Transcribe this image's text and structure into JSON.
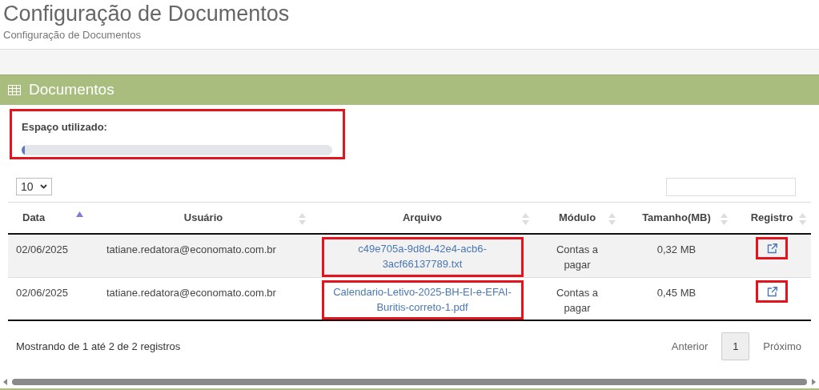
{
  "page": {
    "title": "Configuração de Documentos",
    "subtitle": "Configuração de Documentos"
  },
  "panel": {
    "title": "Documentos"
  },
  "space_usage": {
    "label": "Espaço utilizado:",
    "level": 0.01,
    "highlighted": true
  },
  "page_length": {
    "value": "10"
  },
  "table": {
    "columns": [
      {
        "label": "Data",
        "sorted": true
      },
      {
        "label": "Usuário",
        "sorted": false
      },
      {
        "label": "Arquivo",
        "sorted": false
      },
      {
        "label": "Módulo",
        "sorted": false
      },
      {
        "label": "Tamanho(MB)",
        "sorted": false
      },
      {
        "label": "Registro",
        "sorted": false
      }
    ],
    "rows": [
      {
        "date": "02/06/2025",
        "user": "tatiane.redatora@economato.com.br",
        "file": "c49e705a-9d8d-42e4-acb6-3acf66137789.txt",
        "module": "Contas a pagar",
        "size": "0,32 MB",
        "highlighted": true
      },
      {
        "date": "02/06/2025",
        "user": "tatiane.redatora@economato.com.br",
        "file": "Calendario-Letivo-2025-BH-EI-e-EFAI-Buritis-correto-1.pdf",
        "module": "Contas a pagar",
        "size": "0,45 MB",
        "highlighted": true
      }
    ]
  },
  "info": "Mostrando de 1 até 2 de 2 registros",
  "pagination": [
    {
      "label": "Anterior",
      "selected": false
    },
    {
      "label": "1",
      "selected": true
    },
    {
      "label": "Próximo",
      "selected": false
    }
  ]
}
